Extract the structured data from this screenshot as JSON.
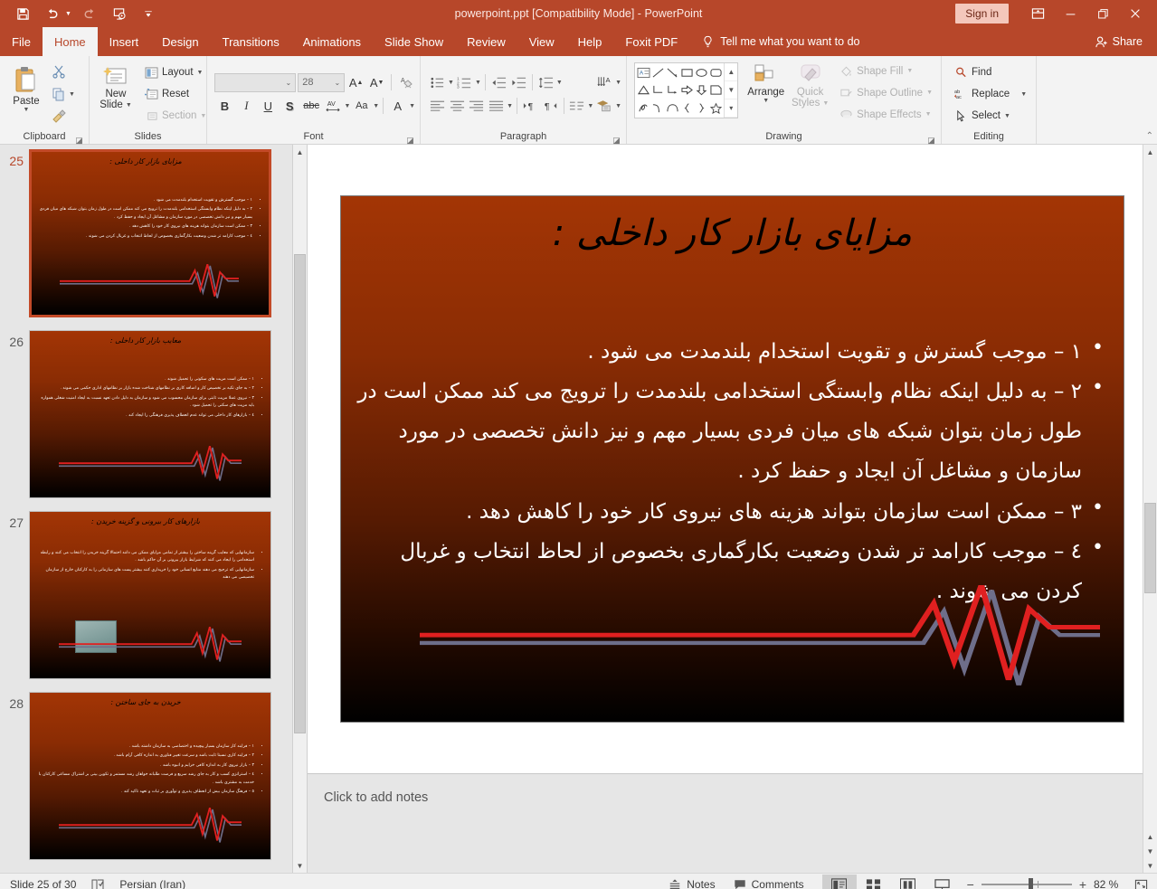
{
  "window": {
    "title": "powerpoint.ppt [Compatibility Mode]  -  PowerPoint",
    "sign_in": "Sign in",
    "accent_color": "#b7472a",
    "quick_access": [
      {
        "name": "save-icon",
        "glyph": "💾"
      },
      {
        "name": "undo-icon",
        "glyph": "↶"
      },
      {
        "name": "redo-icon",
        "glyph": "↻"
      },
      {
        "name": "start-presentation-icon",
        "glyph": "▶"
      },
      {
        "name": "customize-quick-access-toolbar-icon",
        "glyph": "⌵"
      }
    ],
    "controls": [
      {
        "name": "ribbon-display-options-icon",
        "glyph": "⌧"
      },
      {
        "name": "minimize-icon",
        "glyph": "—"
      },
      {
        "name": "restore-icon",
        "glyph": "❐"
      },
      {
        "name": "close-icon",
        "glyph": "✕"
      }
    ]
  },
  "ribbon": {
    "tabs": [
      "File",
      "Home",
      "Insert",
      "Design",
      "Transitions",
      "Animations",
      "Slide Show",
      "Review",
      "View",
      "Help",
      "Foxit PDF"
    ],
    "active_tab": "Home",
    "tell_me": "Tell me what you want to do",
    "share": "Share",
    "groups": {
      "clipboard": {
        "label": "Clipboard",
        "paste": "Paste",
        "buttons": [
          "Cut",
          "Copy",
          "Format Painter"
        ]
      },
      "slides": {
        "label": "Slides",
        "new_slide": "New Slide",
        "layout": "Layout",
        "reset": "Reset",
        "section": "Section"
      },
      "font": {
        "label": "Font",
        "font_name": "",
        "font_name_placeholder": "",
        "font_size": "28",
        "buttons": [
          "B",
          "I",
          "U",
          "S",
          "abc",
          "AV",
          "Aa",
          "A"
        ]
      },
      "paragraph": {
        "label": "Paragraph"
      },
      "drawing": {
        "label": "Drawing",
        "arrange": "Arrange",
        "quick_styles": "Quick Styles",
        "shape_fill": "Shape Fill",
        "shape_outline": "Shape Outline",
        "shape_effects": "Shape Effects"
      },
      "editing": {
        "label": "Editing",
        "find": "Find",
        "replace": "Replace",
        "select": "Select"
      }
    }
  },
  "slides": [
    {
      "number": "25",
      "selected": true,
      "title": "مزایای بازار کار داخلی :",
      "has_image": false,
      "bullets": [
        "١ – موجب گسترش و تقویت استخدام بلندمدت می شود .",
        "٢ – به دلیل اینکه نظام وابستگی استخدامی بلندمدت را ترویج می کند ممکن است در طول زمان بتوان شبکه های میان فردی بسیار مهم و نیز دانش تخصصی در مورد سازمان و مشاغل آن ایجاد و حفظ کرد .",
        "٣ – ممکن است سازمان بتواند هزینه های نیروی کار خود را کاهش دهد .",
        "٤ – موجب کارامد تر شدن وضعیت بکارگماری بخصوص از لحاظ انتخاب و غربال کردن می شوند ."
      ]
    },
    {
      "number": "26",
      "selected": false,
      "title": "معایب بازار کار داخلی :",
      "has_image": false,
      "bullets": [
        "١ – ممکن است مزیت های سکونی را تحمیل شوند .",
        "٢ – به جای تکیه بر تخصیص کار و اضافه کاری بر نظامهای شناخت شده بازار بر نظامهای اداری حکمی می شوند .",
        "٣ – نیروی عملا مزیت ثابتی برای سازمان محسوب می شود و سازمان به دلیل دادن تعهد نسبت به ایجاد امنیت شغلی همواره باید مزیت های سکنی را تحمیل شود .",
        "٤ – بازارهای کار داخلی می تواند عدم انعطاف پذیری فرهنگی را ایجاد کند ."
      ]
    },
    {
      "number": "27",
      "selected": false,
      "title": "بازارهای کار بیرونی و گزینه خریدن :",
      "has_image": true,
      "bullets": [
        "سازمانهایی که معایب گزینه ساختن را بیشتر از تمامی مزایای ممکن می دانند احتمالا گزینه خریدن را انتخاب می کنند و رابطه استخدامی را ایجاد می کنند که شرایط بازار بیرونی بر آن حاکم باشد .",
        "سازمانهایی که ترجیح می دهند منابع انسانی خود را خریداری کنند بیشتر پست های سازمانی  را به کارکنان خارج از سازمان تخصیصی می دهند"
      ]
    },
    {
      "number": "28",
      "selected": false,
      "title": "خریدن به جای ساختن :",
      "has_image": false,
      "bullets": [
        "١ – فرایند کار سازمان بسیار پیچیده و اختصاصی به سازمان داشته باشد .",
        "٢ – فرایند کاری نسبتا ثابت باشد و سرعت تغییر فناوری به اندازه کافی آرام باشد .",
        "٣ – بازار نیروی کار به اندازه کافی خرابم و انبوه باشد .",
        "٤ – استراتژی کسب و کار به جای رشد سریع و فرصت طلبانه خواهان رشد مستمر و تکوین بینی بر اشتراک مساعی کارکنان با خدمت به مشتری باشد .",
        "٥ – فرهنگ سازمان بیش از انعطاف پذیری و توآوری بر ثبات و تعهد تاکید کند ."
      ]
    }
  ],
  "notes": {
    "placeholder": "Click to add notes"
  },
  "status": {
    "slide_counter": "Slide 25 of 30",
    "language": "Persian (Iran)",
    "notes_label": "Notes",
    "comments_label": "Comments",
    "zoom_level": "82 %",
    "views": [
      {
        "name": "normal-view-button",
        "glyph": "▣",
        "active": true
      },
      {
        "name": "slide-sorter-view-button",
        "glyph": "☷",
        "active": false
      },
      {
        "name": "reading-view-button",
        "glyph": "▥",
        "active": false
      },
      {
        "name": "slide-show-button",
        "glyph": "☐",
        "active": false
      }
    ],
    "zoom_out": "−",
    "zoom_in": "+",
    "fit_to_window": "⛶"
  }
}
